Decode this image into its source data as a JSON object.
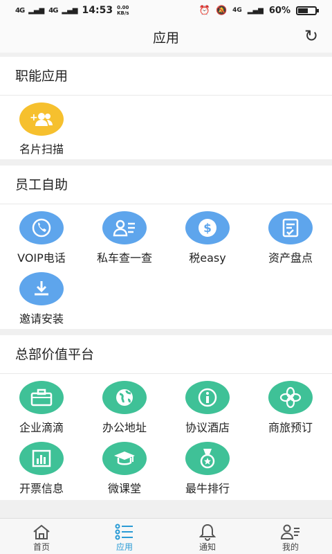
{
  "status": {
    "signal1": "4G",
    "signal2": "4G",
    "time": "14:53",
    "speed_value": "0.00",
    "speed_unit": "KB/s",
    "net": "4G",
    "battery": "60%",
    "battery_level": 0.6
  },
  "header": {
    "title": "应用"
  },
  "sections": [
    {
      "title": "职能应用",
      "apps": [
        {
          "label": "名片扫描",
          "icon": "add-contacts-icon",
          "color": "#f6c02e"
        }
      ]
    },
    {
      "title": "员工自助",
      "apps": [
        {
          "label": "VOIP电话",
          "icon": "phone-icon",
          "color": "#5ea5ec"
        },
        {
          "label": "私车查一查",
          "icon": "person-card-icon",
          "color": "#5ea5ec"
        },
        {
          "label": "税easy",
          "icon": "dollar-icon",
          "color": "#5ea5ec"
        },
        {
          "label": "资产盘点",
          "icon": "checklist-icon",
          "color": "#5ea5ec"
        },
        {
          "label": "邀请安装",
          "icon": "download-icon",
          "color": "#5ea5ec"
        }
      ]
    },
    {
      "title": "总部价值平台",
      "apps": [
        {
          "label": "企业滴滴",
          "icon": "briefcase-icon",
          "color": "#3fc197"
        },
        {
          "label": "办公地址",
          "icon": "globe-icon",
          "color": "#3fc197"
        },
        {
          "label": "协议酒店",
          "icon": "info-icon",
          "color": "#3fc197"
        },
        {
          "label": "商旅预订",
          "icon": "flower-icon",
          "color": "#3fc197"
        },
        {
          "label": "开票信息",
          "icon": "bar-chart-icon",
          "color": "#3fc197"
        },
        {
          "label": "微课堂",
          "icon": "graduation-cap-icon",
          "color": "#3fc197"
        },
        {
          "label": "最牛排行",
          "icon": "medal-icon",
          "color": "#3fc197"
        }
      ]
    }
  ],
  "tabs": [
    {
      "label": "首页",
      "icon": "home-icon",
      "active": false
    },
    {
      "label": "应用",
      "icon": "list-icon",
      "active": true
    },
    {
      "label": "通知",
      "icon": "bell-icon",
      "active": false
    },
    {
      "label": "我的",
      "icon": "profile-icon",
      "active": false
    }
  ]
}
